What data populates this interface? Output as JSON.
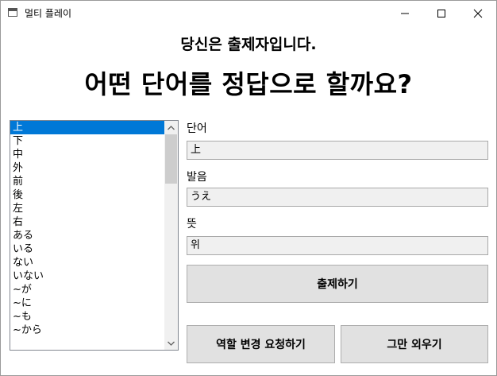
{
  "window": {
    "title": "멀티 플레이",
    "icon": "app-window-icon"
  },
  "titlebar_controls": {
    "minimize_icon": "minimize-icon",
    "maximize_icon": "maximize-icon",
    "close_icon": "close-icon"
  },
  "header": {
    "subtitle": "당신은 출제자입니다.",
    "question": "어떤 단어를 정답으로 할까요?"
  },
  "word_list": {
    "items": [
      "上",
      "下",
      "中",
      "外",
      "前",
      "後",
      "左",
      "右",
      "ある",
      "いる",
      "ない",
      "いない",
      "~が",
      "~に",
      "~も",
      "~から"
    ],
    "selected_index": 0,
    "selected_color": "#0078d7"
  },
  "fields": {
    "word_label": "단어",
    "word_value": "上",
    "pronunciation_label": "발음",
    "pronunciation_value": "うえ",
    "meaning_label": "뜻",
    "meaning_value": "위"
  },
  "buttons": {
    "submit_label": "출제하기",
    "request_role_change_label": "역할 변경 요청하기",
    "stop_label": "그만 외우기"
  }
}
